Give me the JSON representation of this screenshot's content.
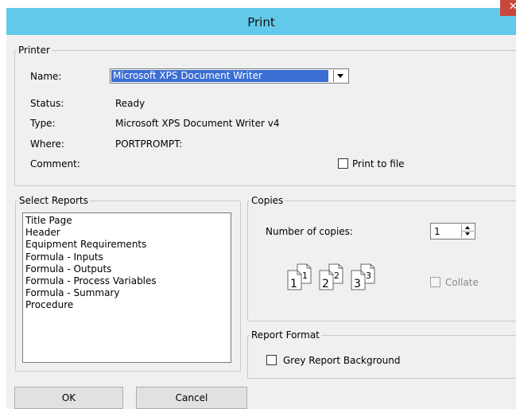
{
  "window": {
    "title": "Print"
  },
  "printer": {
    "group_label": "Printer",
    "name_label": "Name:",
    "name_value": "Microsoft XPS Document Writer",
    "status_label": "Status:",
    "status_value": "Ready",
    "type_label": "Type:",
    "type_value": "Microsoft XPS Document Writer v4",
    "where_label": "Where:",
    "where_value": "PORTPROMPT:",
    "comment_label": "Comment:",
    "print_to_file_label": "Print to file",
    "print_to_file_checked": false
  },
  "reports": {
    "group_label": "Select Reports",
    "items": [
      "Title Page",
      "Header",
      "Equipment Requirements",
      "Formula - Inputs",
      "Formula - Outputs",
      "Formula - Process Variables",
      "Formula - Summary",
      "Procedure"
    ]
  },
  "copies": {
    "group_label": "Copies",
    "number_label": "Number of copies:",
    "number_value": "1",
    "collate_label": "Collate",
    "collate_enabled": false,
    "collate_icons": [
      {
        "big": "1",
        "small": "1"
      },
      {
        "big": "2",
        "small": "2"
      },
      {
        "big": "3",
        "small": "3"
      }
    ]
  },
  "report_format": {
    "group_label": "Report Format",
    "grey_background_label": "Grey Report Background",
    "grey_background_checked": false
  },
  "buttons": {
    "ok": "OK",
    "cancel": "Cancel"
  },
  "colors": {
    "titlebar": "#63c9ea",
    "selection": "#3a6ed3",
    "close": "#c9483b",
    "dialog": "#f0f0f0"
  }
}
